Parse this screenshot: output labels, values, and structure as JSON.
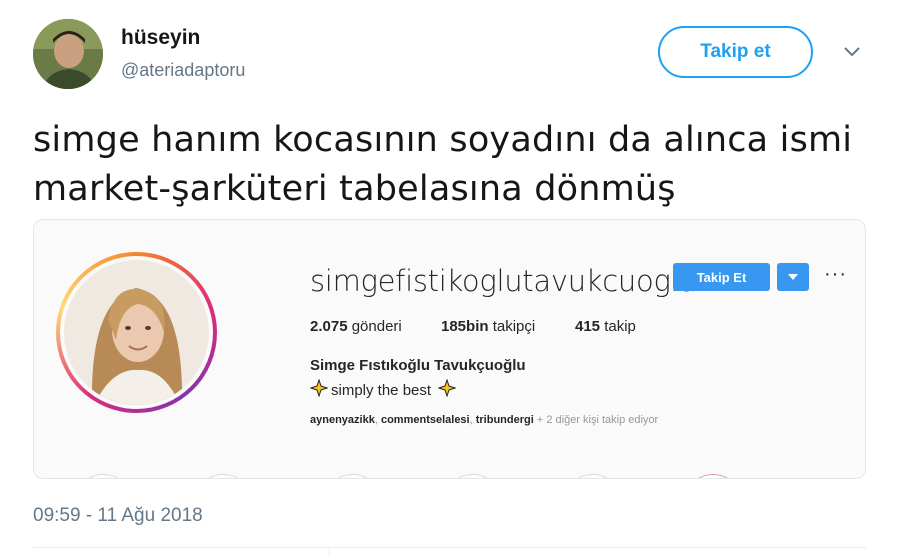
{
  "tweet": {
    "display_name": "hüseyin",
    "handle": "@ateriadaptoru",
    "follow_label": "Takip et",
    "text_line1": "simge hanım kocasının soyadını da alınca ismi",
    "text_line2": "market-şarküteri tabelasına dönmüş",
    "timestamp": "09:59 - 11 Ağu 2018"
  },
  "instagram_card": {
    "username": "simgefistikoglutavukcuoglu",
    "follow_label": "Takip Et",
    "more_label": "···",
    "stats": [
      {
        "value": "2.075",
        "label": "gönderi"
      },
      {
        "value": "185bin",
        "label": "takipçi"
      },
      {
        "value": "415",
        "label": "takip"
      }
    ],
    "full_name": "Simge Fıstıkoğlu Tavukçuoğlu",
    "bio": "simply the best",
    "followed_by": [
      "aynenyazikk",
      "commentselalesi",
      "tribundergi"
    ],
    "followed_by_more": "+ 2 diğer kişi takip ediyor"
  },
  "colors": {
    "twitter_blue": "#1da1f2",
    "instagram_blue": "#3897f0",
    "muted_text": "#657786"
  },
  "icons": [
    "chevron-down-icon",
    "caret-down-icon",
    "sparkle-icon"
  ]
}
